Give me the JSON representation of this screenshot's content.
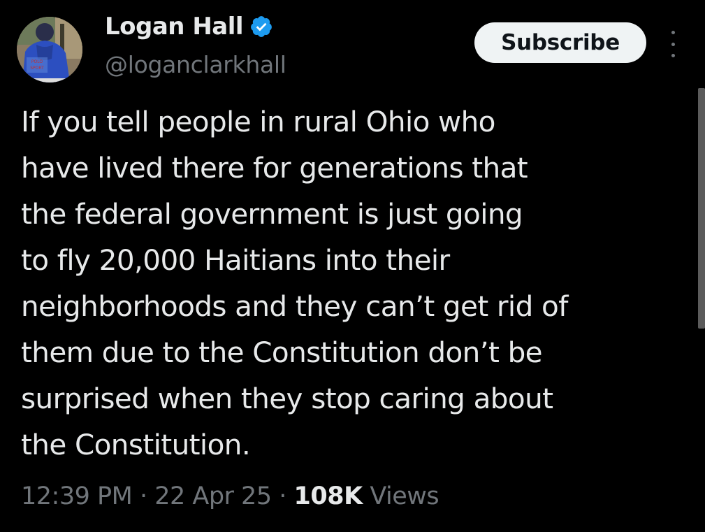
{
  "author": {
    "display_name": "Logan Hall",
    "handle": "@loganclarkhall",
    "verified": true,
    "avatar_icon": "profile-photo",
    "avatar_jacket_text": [
      "POLO",
      "SPORT"
    ]
  },
  "actions": {
    "subscribe_label": "Subscribe",
    "more_icon": "vertical-ellipsis-icon"
  },
  "tweet": {
    "lines": [
      "If you tell people in rural Ohio who",
      "have lived there for generations that",
      "the federal government is just going",
      "to fly 20,000 Haitians into their",
      "neighborhoods and they can’t get rid of",
      "them due to the Constitution don’t be",
      "surprised when they stop caring about",
      "the Constitution."
    ]
  },
  "meta": {
    "time": "12:39 PM",
    "separator": "·",
    "date": "22 Apr 25",
    "views_count": "108K",
    "views_label": "Views"
  },
  "colors": {
    "background": "#000000",
    "primary_text": "#e7e9ea",
    "secondary_text": "#71767b",
    "verified_badge": "#1d9bf0",
    "button_bg": "#eff3f4",
    "button_text": "#0f1419"
  }
}
